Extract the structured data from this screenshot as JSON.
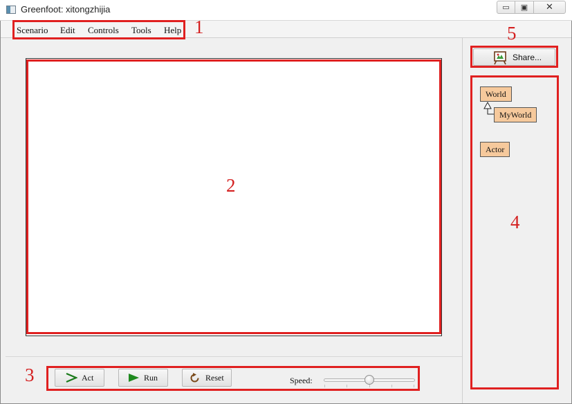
{
  "window": {
    "title": "Greenfoot: xitongzhijia",
    "min_glyph": "▭",
    "max_glyph": "▣",
    "close_glyph": "✕"
  },
  "menu": {
    "items": [
      "Scenario",
      "Edit",
      "Controls",
      "Tools",
      "Help"
    ]
  },
  "controls": {
    "act_label": "Act",
    "run_label": "Run",
    "reset_label": "Reset",
    "speed_label": "Speed:",
    "speed_value": 0.5
  },
  "share": {
    "label": "Share..."
  },
  "class_diagram": {
    "world": "World",
    "myworld": "MyWorld",
    "actor": "Actor"
  },
  "annotations": {
    "menu_number": "1",
    "world_number": "2",
    "controls_number": "3",
    "classes_number": "4",
    "share_number": "5"
  },
  "colors": {
    "annotation": "#e02020",
    "class_fill": "#f6c99c",
    "act_icon": "#1a7a1a",
    "run_icon": "#1f8a1f",
    "reset_icon": "#7a4a1a"
  }
}
